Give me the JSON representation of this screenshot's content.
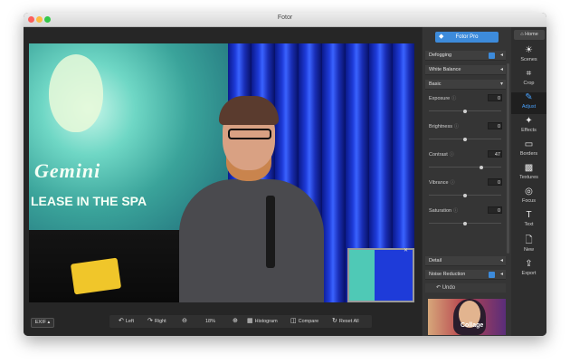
{
  "window": {
    "title": "Fotor"
  },
  "toolbar": {
    "exif": "EXIF",
    "left": "Left",
    "right": "Right",
    "zoom": "18%",
    "histogram": "Histogram",
    "compare": "Compare",
    "reset_all": "Reset  All"
  },
  "panel": {
    "pro": "Fotor Pro",
    "defogging": "Defogging",
    "white_balance": "White Balance",
    "basic": "Basic",
    "adjustments": [
      {
        "label": "Exposure",
        "value": "0",
        "level": 0.5
      },
      {
        "label": "Brightness",
        "value": "0",
        "level": 0.5
      },
      {
        "label": "Contrast",
        "value": "47",
        "level": 0.72
      },
      {
        "label": "Vibrance",
        "value": "0",
        "level": 0.5
      },
      {
        "label": "Saturation",
        "value": "0",
        "level": 0.5
      }
    ],
    "detail": "Detail",
    "noise_reduction": "Noise Reduction",
    "undo": "Undo",
    "ad_text": "Collage"
  },
  "sidebar": {
    "home": "Home",
    "items": [
      {
        "label": "Scenes",
        "icon": "sun-icon",
        "active": false
      },
      {
        "label": "Crop",
        "icon": "crop-icon",
        "active": false
      },
      {
        "label": "Adjust",
        "icon": "brush-icon",
        "active": true
      },
      {
        "label": "Effects",
        "icon": "sparkle-icon",
        "active": false
      },
      {
        "label": "Borders",
        "icon": "border-icon",
        "active": false
      },
      {
        "label": "Textures",
        "icon": "texture-icon",
        "active": false
      },
      {
        "label": "Focus",
        "icon": "focus-icon",
        "active": false
      },
      {
        "label": "Text",
        "icon": "text-icon",
        "active": false
      },
      {
        "label": "New",
        "icon": "new-file-icon",
        "active": false
      },
      {
        "label": "Export",
        "icon": "export-icon",
        "active": false
      }
    ]
  },
  "colors": {
    "accent": "#3d8bdb",
    "panel": "#353535",
    "background": "#2b2b2b"
  }
}
